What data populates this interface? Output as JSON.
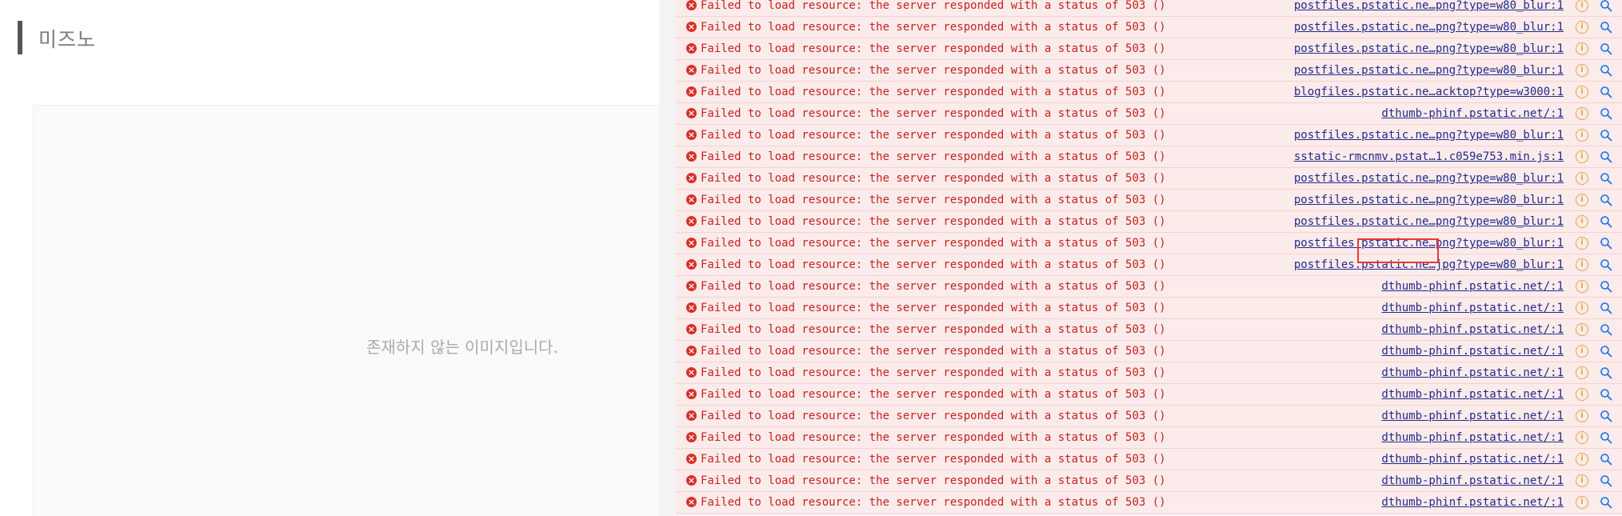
{
  "blog": {
    "title": "미즈노",
    "missing_image_text": "존재하지 않는 이미지입니다."
  },
  "console": {
    "rows": [
      {
        "message": "Failed to load resource: the server responded with a status of 503 ()",
        "source": "postfiles.pstatic.ne…png?type=w80_blur:1"
      },
      {
        "message": "Failed to load resource: the server responded with a status of 503 ()",
        "source": "postfiles.pstatic.ne…png?type=w80_blur:1"
      },
      {
        "message": "Failed to load resource: the server responded with a status of 503 ()",
        "source": "postfiles.pstatic.ne…png?type=w80_blur:1"
      },
      {
        "message": "Failed to load resource: the server responded with a status of 503 ()",
        "source": "postfiles.pstatic.ne…png?type=w80_blur:1"
      },
      {
        "message": "Failed to load resource: the server responded with a status of 503 ()",
        "source": "blogfiles.pstatic.ne…acktop?type=w3000:1"
      },
      {
        "message": "Failed to load resource: the server responded with a status of 503 ()",
        "source": "dthumb-phinf.pstatic.net/:1"
      },
      {
        "message": "Failed to load resource: the server responded with a status of 503 ()",
        "source": "postfiles.pstatic.ne…png?type=w80_blur:1"
      },
      {
        "message": "Failed to load resource: the server responded with a status of 503 ()",
        "source": "sstatic-rmcnmv.pstat…1.c059e753.min.js:1"
      },
      {
        "message": "Failed to load resource: the server responded with a status of 503 ()",
        "source": "postfiles.pstatic.ne…png?type=w80_blur:1"
      },
      {
        "message": "Failed to load resource: the server responded with a status of 503 ()",
        "source": "postfiles.pstatic.ne…png?type=w80_blur:1"
      },
      {
        "message": "Failed to load resource: the server responded with a status of 503 ()",
        "source": "postfiles.pstatic.ne…png?type=w80_blur:1"
      },
      {
        "message": "Failed to load resource: the server responded with a status of 503 ()",
        "source": "postfiles.pstatic.ne…png?type=w80_blur:1"
      },
      {
        "message": "Failed to load resource: the server responded with a status of 503 ()",
        "source": "postfiles.pstatic.ne…jpg?type=w80_blur:1"
      },
      {
        "message": "Failed to load resource: the server responded with a status of 503 ()",
        "source": "dthumb-phinf.pstatic.net/:1"
      },
      {
        "message": "Failed to load resource: the server responded with a status of 503 ()",
        "source": "dthumb-phinf.pstatic.net/:1"
      },
      {
        "message": "Failed to load resource: the server responded with a status of 503 ()",
        "source": "dthumb-phinf.pstatic.net/:1"
      },
      {
        "message": "Failed to load resource: the server responded with a status of 503 ()",
        "source": "dthumb-phinf.pstatic.net/:1"
      },
      {
        "message": "Failed to load resource: the server responded with a status of 503 ()",
        "source": "dthumb-phinf.pstatic.net/:1"
      },
      {
        "message": "Failed to load resource: the server responded with a status of 503 ()",
        "source": "dthumb-phinf.pstatic.net/:1"
      },
      {
        "message": "Failed to load resource: the server responded with a status of 503 ()",
        "source": "dthumb-phinf.pstatic.net/:1"
      },
      {
        "message": "Failed to load resource: the server responded with a status of 503 ()",
        "source": "dthumb-phinf.pstatic.net/:1"
      },
      {
        "message": "Failed to load resource: the server responded with a status of 503 ()",
        "source": "dthumb-phinf.pstatic.net/:1"
      },
      {
        "message": "Failed to load resource: the server responded with a status of 503 ()",
        "source": "dthumb-phinf.pstatic.net/:1"
      },
      {
        "message": "Failed to load resource: the server responded with a status of 503 ()",
        "source": "dthumb-phinf.pstatic.net/:1"
      }
    ],
    "error_icon": "error-icon",
    "info_icon": "info-icon",
    "search_icon": "search-icon",
    "error_color": "#c5221f",
    "row_background": "#fcebeb",
    "link_color": "#202a8c"
  }
}
